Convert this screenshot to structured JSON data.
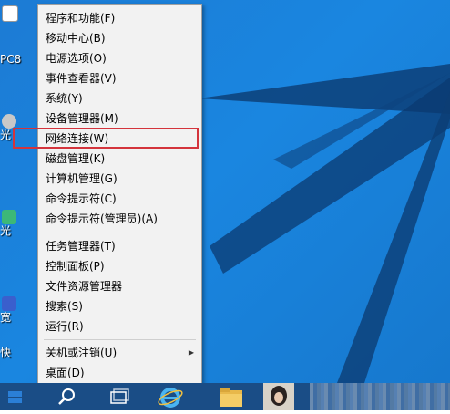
{
  "desktop": {
    "icons": [
      {
        "name": "desktop-icon-top",
        "label": ""
      },
      {
        "name": "desktop-icon-pc",
        "label": "PC8"
      },
      {
        "name": "desktop-icon-guang",
        "label": "光"
      },
      {
        "name": "desktop-icon-guang-2",
        "label": "光"
      },
      {
        "name": "desktop-icon-kuan",
        "label": "宽"
      },
      {
        "name": "desktop-icon-kuai",
        "label": "快"
      }
    ]
  },
  "context_menu": {
    "items": [
      {
        "label": "程序和功能(F)"
      },
      {
        "label": "移动中心(B)"
      },
      {
        "label": "电源选项(O)"
      },
      {
        "label": "事件查看器(V)"
      },
      {
        "label": "系统(Y)"
      },
      {
        "label": "设备管理器(M)"
      },
      {
        "label": "网络连接(W)"
      },
      {
        "label": "磁盘管理(K)"
      },
      {
        "label": "计算机管理(G)"
      },
      {
        "label": "命令提示符(C)"
      },
      {
        "label": "命令提示符(管理员)(A)"
      },
      {
        "label": "任务管理器(T)"
      },
      {
        "label": "控制面板(P)"
      },
      {
        "label": "文件资源管理器"
      },
      {
        "label": "搜索(S)"
      },
      {
        "label": "运行(R)"
      },
      {
        "label": "关机或注销(U)",
        "submenu_arrow": "▶"
      },
      {
        "label": "桌面(D)"
      }
    ],
    "highlighted": "网络连接(W)"
  },
  "taskbar": {
    "buttons": [
      "start-icon",
      "search-icon",
      "task-view-icon",
      "internet-explorer-icon",
      "file-explorer-icon",
      "photo-thumbnail"
    ]
  },
  "colors": {
    "desktop": "#1a86e0",
    "menu_bg": "#f2f2f2",
    "highlight_border": "#d4343c",
    "taskbar": "#1a4d86"
  }
}
